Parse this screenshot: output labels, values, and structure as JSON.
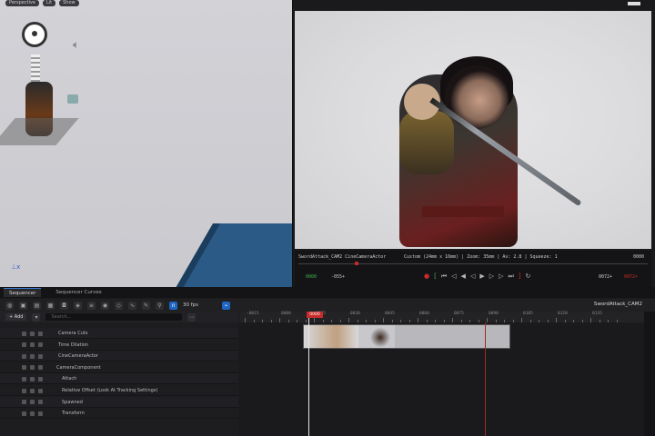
{
  "viewport_left": {
    "chips": [
      "Perspective",
      "Lit",
      "Show"
    ],
    "camera_label": "Cine Camera Actor"
  },
  "viewport_right": {
    "camera_info": "SwordAttack_CAM2 CineCameraActor",
    "lens_info": "Custom (24mm x 16mm) | Zoom: 35mm | Av: 2.8 | Squeeze: 1",
    "frame_right": "0000",
    "tc_left": "0000",
    "tc_left2": "-055+",
    "tc_right": "0072+",
    "tc_right2": "0072+"
  },
  "sequencer": {
    "tabs": [
      "Sequencer",
      "Sequencer Curves"
    ],
    "fps": "30 fps",
    "sequence_name": "SwordAttack_CAM2",
    "add_label": "+ Add",
    "search_placeholder": "Search...",
    "playhead": "0000",
    "ruler_labels": [
      "-0015",
      "0000",
      "0015",
      "0030",
      "0045",
      "0060",
      "0075",
      "0090",
      "0105",
      "0120",
      "0135"
    ],
    "tracks": [
      {
        "label": "Camera Cuts",
        "indent": 64
      },
      {
        "label": "Time Dilation",
        "indent": 64
      },
      {
        "label": "CineCameraActor",
        "indent": 64
      },
      {
        "label": "CameraComponent",
        "indent": 62
      },
      {
        "label": "Attach",
        "indent": 68
      },
      {
        "label": "Relative Offset (Look At Tracking Settings)",
        "indent": 68
      },
      {
        "label": "Spawned",
        "indent": 68
      },
      {
        "label": "Transform",
        "indent": 68
      }
    ]
  },
  "colors": {
    "accent": "#1f66c2",
    "playhead": "#c92b2b",
    "key": "#d98a2b"
  }
}
